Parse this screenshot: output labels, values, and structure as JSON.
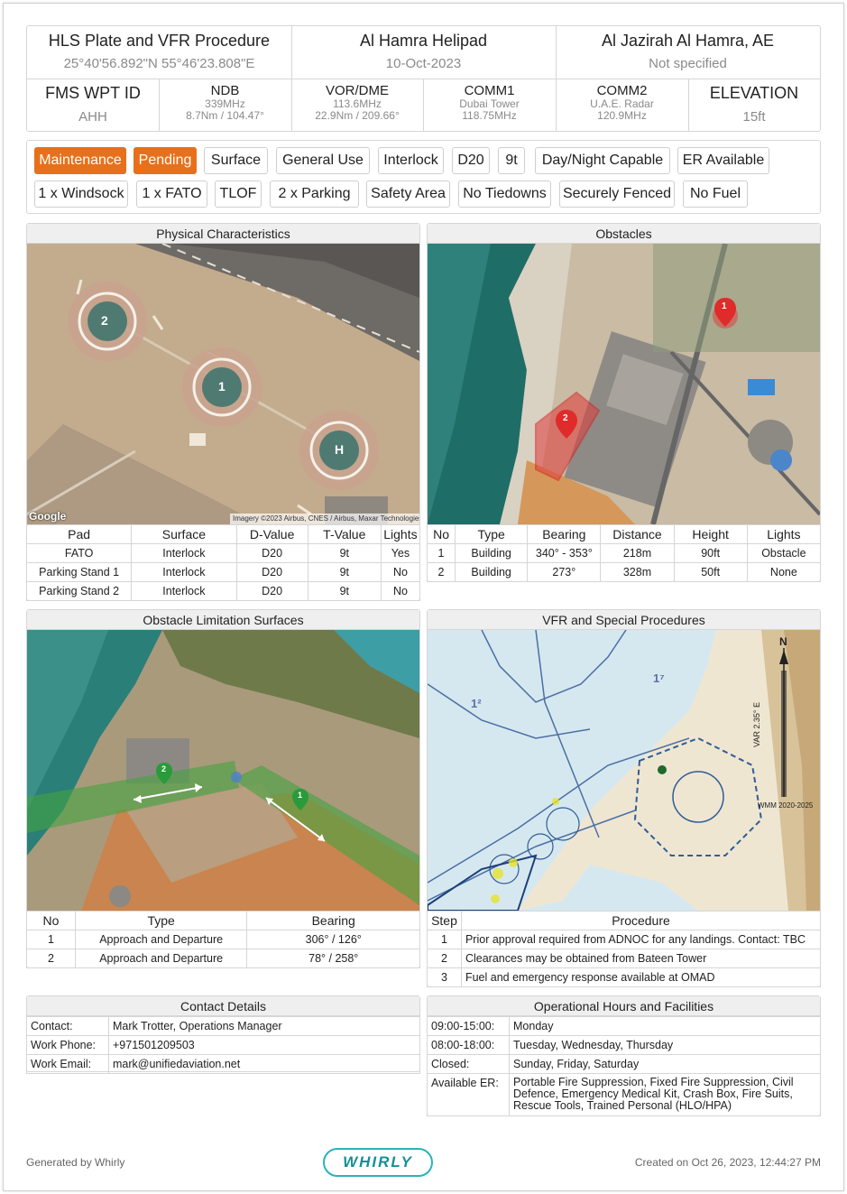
{
  "header": {
    "row1": [
      {
        "title": "HLS Plate and VFR Procedure",
        "sub": "25°40'56.892\"N 55°46'23.808\"E"
      },
      {
        "title": "Al Hamra Helipad",
        "sub": "10-Oct-2023"
      },
      {
        "title": "Al Jazirah Al Hamra, AE",
        "sub": "Not specified"
      }
    ],
    "fms": {
      "title": "FMS WPT ID",
      "value": "AHH"
    },
    "ndb": {
      "title": "NDB",
      "l1": "339MHz",
      "l2": "8.7Nm / 104.47°"
    },
    "vor": {
      "title": "VOR/DME",
      "l1": "113.6MHz",
      "l2": "22.9Nm / 209.66°"
    },
    "comm1": {
      "title": "COMM1",
      "l1": "Dubai Tower",
      "l2": "118.75MHz"
    },
    "comm2": {
      "title": "COMM2",
      "l1": "U.A.E. Radar",
      "l2": "120.9MHz"
    },
    "elevation": {
      "title": "ELEVATION",
      "value": "15ft"
    }
  },
  "tags": {
    "row1": [
      "Maintenance",
      "Pending",
      "Surface",
      "General Use",
      "Interlock",
      "D20",
      "9t",
      "Day/Night Capable",
      "ER Available"
    ],
    "row2": [
      "1 x Windsock",
      "1 x FATO",
      "TLOF",
      "2 x Parking",
      "Safety Area",
      "No Tiedowns",
      "Securely Fenced",
      "No Fuel"
    ],
    "highlight_color": "#e8701a"
  },
  "physical": {
    "title": "Physical Characteristics",
    "map_credit": "Imagery ©2023 Airbus, CNES / Airbus, Maxar Technologies",
    "google": "Google",
    "pad_labels": [
      "2",
      "1",
      "H"
    ],
    "headers": [
      "Pad",
      "Surface",
      "D-Value",
      "T-Value",
      "Lights"
    ],
    "rows": [
      [
        "FATO",
        "Interlock",
        "D20",
        "9t",
        "Yes"
      ],
      [
        "Parking Stand 1",
        "Interlock",
        "D20",
        "9t",
        "No"
      ],
      [
        "Parking Stand 2",
        "Interlock",
        "D20",
        "9t",
        "No"
      ]
    ]
  },
  "obstacles": {
    "title": "Obstacles",
    "markers": [
      "1",
      "2"
    ],
    "headers": [
      "No",
      "Type",
      "Bearing",
      "Distance",
      "Height",
      "Lights"
    ],
    "rows": [
      [
        "1",
        "Building",
        "340° - 353°",
        "218m",
        "90ft",
        "Obstacle"
      ],
      [
        "2",
        "Building",
        "273°",
        "328m",
        "50ft",
        "None"
      ]
    ]
  },
  "ols": {
    "title": "Obstacle Limitation Surfaces",
    "markers": [
      "2",
      "1"
    ],
    "headers": [
      "No",
      "Type",
      "Bearing"
    ],
    "rows": [
      [
        "1",
        "Approach and Departure",
        "306° / 126°"
      ],
      [
        "2",
        "Approach and Departure",
        "78° / 258°"
      ]
    ]
  },
  "vfr": {
    "title": "VFR and Special Procedures",
    "north": "N",
    "var": "VAR 2.35° E",
    "wmm": "WMM 2020-2025",
    "sector_labels": [
      "1²",
      "1⁷"
    ],
    "headers": [
      "Step",
      "Procedure"
    ],
    "rows": [
      [
        "1",
        "Prior approval required from ADNOC for any landings. Contact: TBC"
      ],
      [
        "2",
        "Clearances may be obtained from Bateen Tower"
      ],
      [
        "3",
        "Fuel and emergency response available at OMAD"
      ]
    ]
  },
  "contact": {
    "title": "Contact Details",
    "rows": [
      [
        "Contact:",
        "Mark Trotter, Operations Manager"
      ],
      [
        "Work Phone:",
        "+971501209503"
      ],
      [
        "Work Email:",
        "mark@unifiedaviation.net"
      ]
    ]
  },
  "hours": {
    "title": "Operational Hours and Facilities",
    "rows": [
      [
        "09:00-15:00:",
        "Monday"
      ],
      [
        "08:00-18:00:",
        "Tuesday, Wednesday, Thursday"
      ],
      [
        "Closed:",
        "Sunday, Friday, Saturday"
      ],
      [
        "Available ER:",
        "Portable Fire Suppression, Fixed Fire Suppression, Civil Defence, Emergency Medical Kit, Crash Box, Fire Suits, Rescue Tools, Trained Personal (HLO/HPA)"
      ]
    ]
  },
  "footer": {
    "generated": "Generated by Whirly",
    "logo": "WHIRLY",
    "created": "Created on Oct 26, 2023, 12:44:27 PM"
  }
}
